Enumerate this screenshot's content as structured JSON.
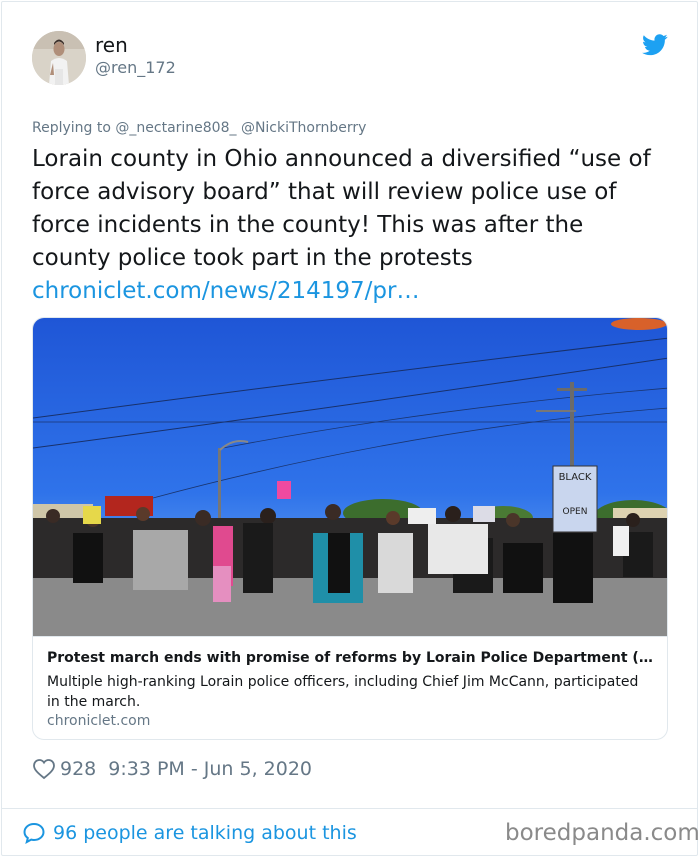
{
  "author": {
    "name": "ren",
    "handle": "@ren_172",
    "avatar_icon": "user-avatar"
  },
  "brand_icon": "twitter-bird-icon",
  "colors": {
    "link": "#1b95e0",
    "secondary_text": "#657786",
    "primary_text": "#14171a",
    "border": "#e1e8ed"
  },
  "reply": {
    "prefix": "Replying to",
    "mentions": "@_nectarine808_ @NickiThornberry"
  },
  "tweet": {
    "text": "Lorain county in Ohio announced a diversified “use of force advisory board” that will review police use of force incidents in the county! This was after the county police took part in the protests",
    "link": "chroniclet.com/news/214197/pr…"
  },
  "link_card": {
    "title": "Protest march ends with promise of reforms by Lorain Police Department (…",
    "description": "Multiple high-ranking Lorain police officers, including Chief Jim McCann, participated in the march.",
    "domain": "chroniclet.com",
    "sign_text": "BLACK",
    "sign_text_2": "OPEN"
  },
  "meta": {
    "likes": "928",
    "timestamp": "9:33 PM - Jun 5, 2020",
    "like_icon": "heart-icon"
  },
  "footer": {
    "talking": "96 people are talking about this",
    "talking_icon": "speech-bubble-icon",
    "watermark": "boredpanda.com"
  }
}
